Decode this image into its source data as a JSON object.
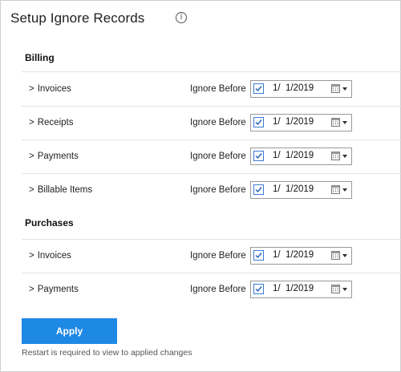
{
  "header": {
    "title": "Setup Ignore Records",
    "info_icon": "info-icon"
  },
  "sections": [
    {
      "title": "Billing",
      "rows": [
        {
          "label": "Invoices",
          "ignore_label": "Ignore Before",
          "checked": true,
          "date": "1/  1/2019"
        },
        {
          "label": "Receipts",
          "ignore_label": "Ignore Before",
          "checked": true,
          "date": "1/  1/2019"
        },
        {
          "label": "Payments",
          "ignore_label": "Ignore Before",
          "checked": true,
          "date": "1/  1/2019"
        },
        {
          "label": "Billable Items",
          "ignore_label": "Ignore Before",
          "checked": true,
          "date": "1/  1/2019"
        }
      ]
    },
    {
      "title": "Purchases",
      "rows": [
        {
          "label": "Invoices",
          "ignore_label": "Ignore Before",
          "checked": true,
          "date": "1/  1/2019"
        },
        {
          "label": "Payments",
          "ignore_label": "Ignore Before",
          "checked": true,
          "date": "1/  1/2019"
        }
      ]
    }
  ],
  "chevron": ">",
  "apply_label": "Apply",
  "note": "Restart is required to view to applied changes",
  "colors": {
    "accent": "#1e88e5",
    "checkbox_border": "#3a7bd5",
    "divider": "#e3e3e3"
  }
}
